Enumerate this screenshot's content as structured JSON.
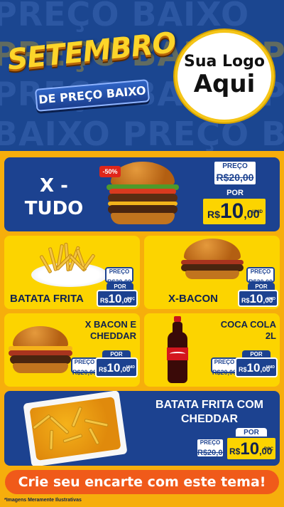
{
  "header": {
    "bg_row_top": "PREÇO BAIXO",
    "bg_row_mid": "PREÇO BAIXO PRE",
    "bg_row_bot": "BAIXO PREÇO BAIXO",
    "title": "SETEMBRO",
    "subtitle": "DE PREÇO BAIXO",
    "logo_line1": "Sua Logo",
    "logo_line2": "Aqui"
  },
  "products": [
    {
      "name_l1": "X -",
      "name_l2": "TUDO",
      "price_label": "PREÇO",
      "old_price": "R$20,00",
      "por": "POR",
      "currency": "R$",
      "int": "10",
      "dec": ",00",
      "unit": "UNID",
      "badge": "-50%"
    },
    {
      "name": "BATATA FRITA",
      "price_label": "PREÇO",
      "old_price": "R$20,00",
      "por": "POR",
      "currency": "R$",
      "int": "10",
      "dec": ",00",
      "unit": "POÇ"
    },
    {
      "name": "X-BACON",
      "price_label": "PREÇO",
      "old_price": "R$20,00",
      "por": "POR",
      "currency": "R$",
      "int": "10",
      "dec": ",00",
      "unit": "UNID"
    },
    {
      "name_l1": "X BACON E",
      "name_l2": "CHEDDAR",
      "price_label": "PREÇO",
      "old_price": "R$20,00",
      "por": "POR",
      "currency": "R$",
      "int": "10",
      "dec": ",00",
      "unit": "UNID"
    },
    {
      "name_l1": "COCA COLA",
      "name_l2": "2L",
      "price_label": "PREÇO",
      "old_price": "R$20,00",
      "por": "POR",
      "currency": "R$",
      "int": "10",
      "dec": ",00",
      "unit": "UNID"
    },
    {
      "name_l1": "BATATA FRITA COM",
      "name_l2": "CHEDDAR",
      "price_label": "PREÇO",
      "old_price": "R$20,00",
      "por": "POR",
      "currency": "R$",
      "int": "10",
      "dec": ",00",
      "unit": "POÇ"
    }
  ],
  "footer": {
    "cta": "Crie seu encarte com este tema!",
    "disclaimer": "*Imagens Meramente Ilustrativas"
  },
  "colors": {
    "navy": "#1c4290",
    "yellow": "#fcd400",
    "orange": "#f6ae0c",
    "cta": "#f05a1a"
  }
}
